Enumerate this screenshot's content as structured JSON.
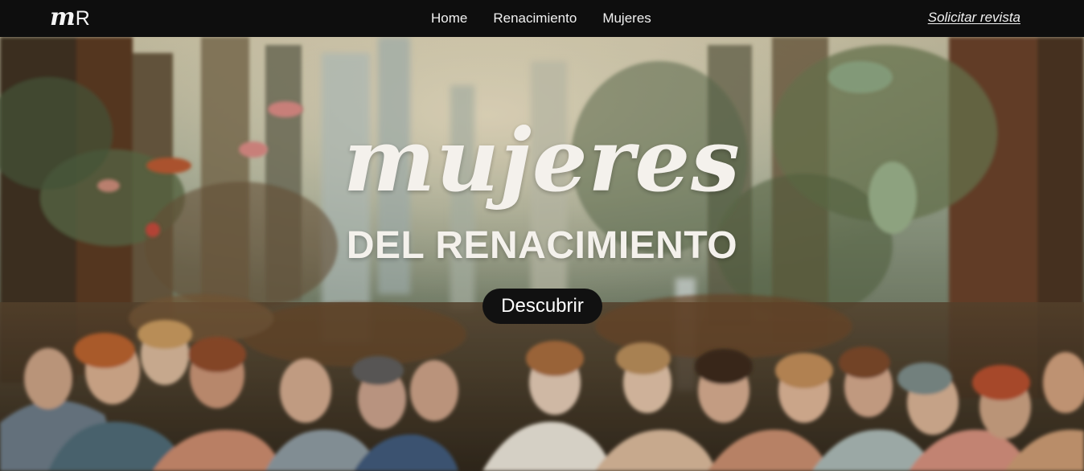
{
  "logo": {
    "script": "m",
    "letter": "R"
  },
  "nav": {
    "items": [
      {
        "label": "Home"
      },
      {
        "label": "Renacimiento"
      },
      {
        "label": "Mujeres"
      }
    ],
    "cta_label": "Solicitar revista"
  },
  "hero": {
    "title": "mujeres",
    "subtitle": "DEL RENACIMIENTO",
    "button_label": "Descubrir"
  },
  "colors": {
    "navbar": "#0e0e0e",
    "title_text": "#f4f1ec",
    "button_bg": "#111111"
  }
}
